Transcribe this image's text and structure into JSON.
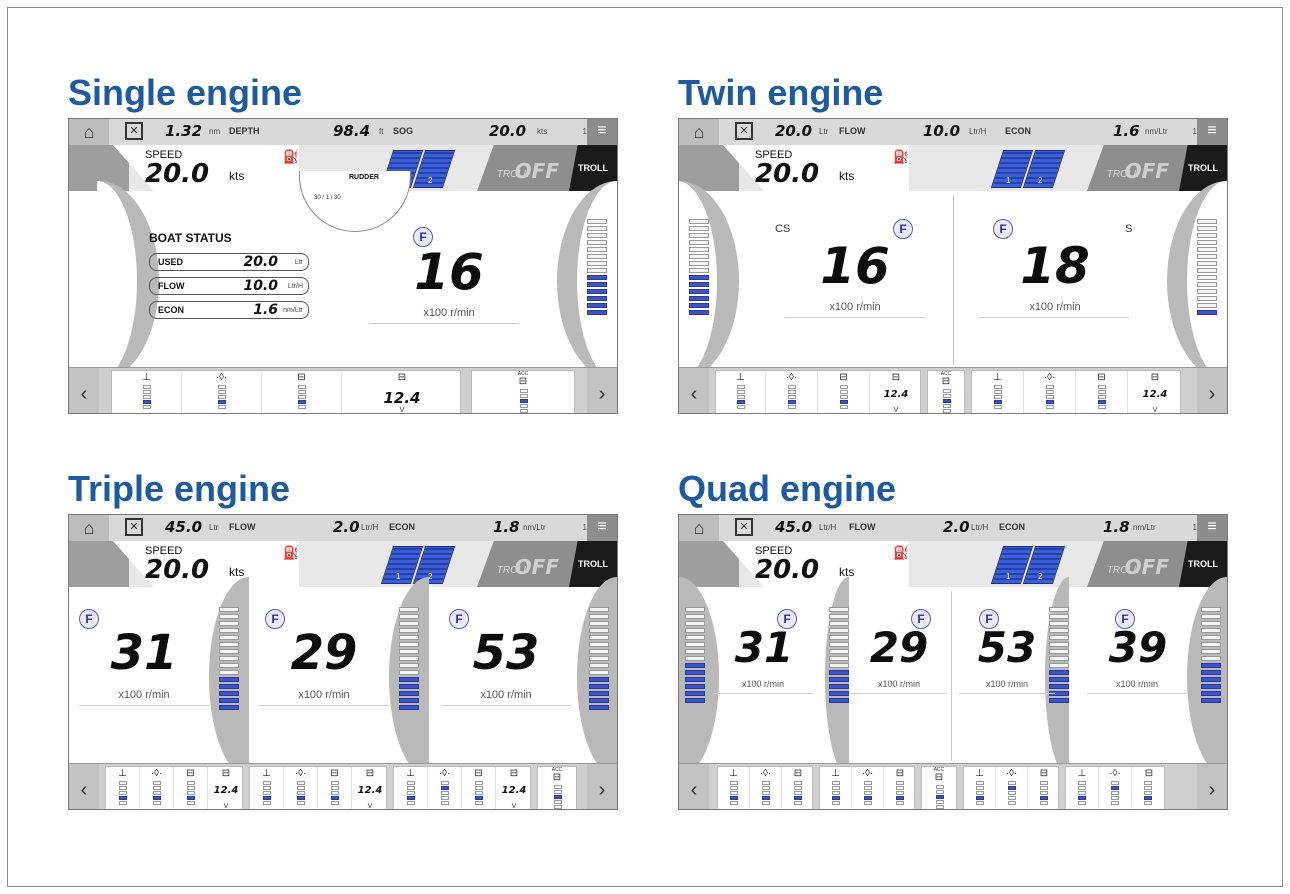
{
  "sections": {
    "single": "Single engine",
    "twin": "Twin engine",
    "triple": "Triple engine",
    "quad": "Quad engine"
  },
  "common": {
    "speed_label": "SPEED",
    "speed_value": "20.0",
    "speed_unit": "kts",
    "troll_label": "TROLL",
    "troll_state": "OFF",
    "troll_button": "TROLL",
    "rpm_unit": "x100 r/min",
    "engine_badge": "F",
    "throttle_1": "1",
    "throttle_2": "2",
    "volt_value": "12.4",
    "volt_unit": "V",
    "acc_label": "ACC",
    "icons": [
      "home-icon",
      "navigation-icon",
      "menu-icon",
      "fuel-icon",
      "temperature-icon",
      "oil-pressure-icon",
      "battery-icon",
      "accessory-battery-icon",
      "chevron-left-icon",
      "chevron-right-icon"
    ]
  },
  "single": {
    "top": [
      {
        "value": "1.32",
        "unit": "nm",
        "label": "DEPTH"
      },
      {
        "value": "98.4",
        "unit": "ft",
        "label": "SOG"
      },
      {
        "value": "20.0",
        "unit": "kts",
        "label": ""
      }
    ],
    "clock": "1",
    "boat_status_title": "BOAT STATUS",
    "status": [
      {
        "label": "USED",
        "value": "20.0",
        "unit": "Ltr"
      },
      {
        "label": "FLOW",
        "value": "10.0",
        "unit": "Ltr/H"
      },
      {
        "label": "ECON",
        "value": "1.6",
        "unit": "nm/Ltr"
      }
    ],
    "rudder_label": "RUDDER",
    "rudder_scale": "30 / 1 \\ 30",
    "rpm": "16",
    "led_level": 6,
    "led_total": 14
  },
  "twin": {
    "top": [
      {
        "value": "20.0",
        "unit": "Ltr",
        "label": "FLOW"
      },
      {
        "value": "10.0",
        "unit": "Ltr/H",
        "label": "ECON"
      },
      {
        "value": "1.6",
        "unit": "nm/Ltr",
        "label": ""
      }
    ],
    "clock": "1",
    "engines": [
      {
        "label": "CS",
        "rpm": "16",
        "led_level": 6
      },
      {
        "label": "S",
        "rpm": "18",
        "led_level": 1
      }
    ]
  },
  "triple": {
    "top": [
      {
        "value": "45.0",
        "unit": "Ltr",
        "label": "FLOW"
      },
      {
        "value": "2.0",
        "unit": "Ltr/H",
        "label": "ECON"
      },
      {
        "value": "1.8",
        "unit": "nm/Ltr",
        "label": ""
      }
    ],
    "clock": "1",
    "engines": [
      {
        "rpm": "31",
        "led_level": 5
      },
      {
        "rpm": "29",
        "led_level": 5
      },
      {
        "rpm": "53",
        "led_level": 5
      }
    ]
  },
  "quad": {
    "top": [
      {
        "value": "45.0",
        "unit": "Ltr/H",
        "label": "FLOW"
      },
      {
        "value": "2.0",
        "unit": "Ltr/H",
        "label": "ECON"
      },
      {
        "value": "1.8",
        "unit": "nm/Ltr",
        "label": ""
      }
    ],
    "clock": "1",
    "engines": [
      {
        "rpm": "31",
        "led_level": 6
      },
      {
        "rpm": "29",
        "led_level": 5
      },
      {
        "rpm": "53",
        "led_level": 5
      },
      {
        "rpm": "39",
        "led_level": 6
      }
    ]
  }
}
